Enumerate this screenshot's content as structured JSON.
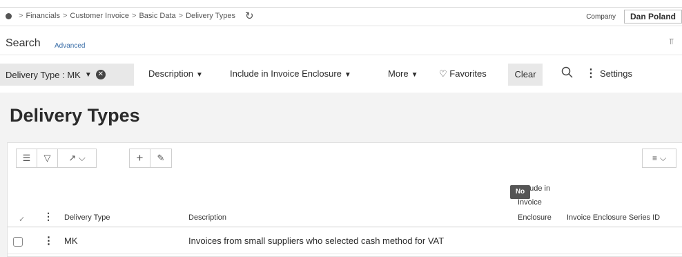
{
  "breadcrumb": {
    "items": [
      "Financials",
      "Customer Invoice",
      "Basic Data",
      "Delivery Types"
    ]
  },
  "company": {
    "label": "Company",
    "value": "Dan Poland"
  },
  "search": {
    "title": "Search",
    "advanced_label": "Advanced"
  },
  "filters": {
    "active_chip": "Delivery Type : MK",
    "buttons": [
      "Description",
      "Include in Invoice Enclosure",
      "More"
    ],
    "favorites_label": "Favorites",
    "clear_label": "Clear",
    "settings_label": "Settings"
  },
  "page": {
    "title": "Delivery Types"
  },
  "table": {
    "columns": {
      "delivery_type": "Delivery Type",
      "description": "Description",
      "include_line1": "Include in",
      "include_line2": "Invoice",
      "include_line3": "Enclosure",
      "series_id": "Invoice Enclosure Series ID"
    },
    "rows": [
      {
        "delivery_type": "MK",
        "description": "Invoices from small suppliers who selected cash method for VAT",
        "include_in_invoice_enclosure": "No",
        "series_id": ""
      }
    ]
  },
  "icons": {
    "home": "home-dot-icon",
    "refresh": "refresh-icon",
    "pin": "pin-icon",
    "search": "search-icon",
    "favorites": "heart-icon"
  },
  "colors": {
    "link": "#3a6ea8",
    "chip_bg": "#e8e8e8",
    "badge_bg": "#555555",
    "page_bg": "#f3f3f3"
  }
}
